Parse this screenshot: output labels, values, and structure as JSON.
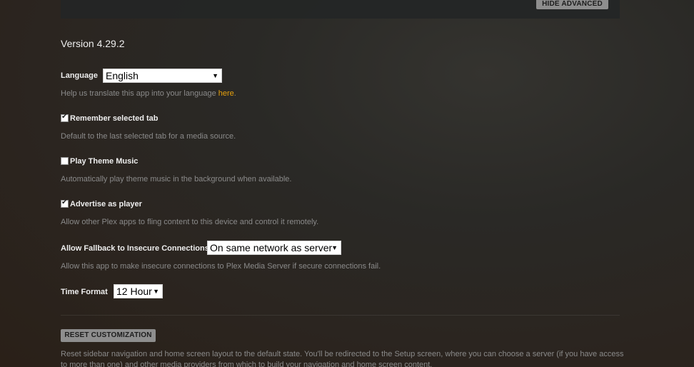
{
  "header": {
    "hide_advanced_label": "HIDE ADVANCED"
  },
  "version": "Version 4.29.2",
  "language": {
    "label": "Language",
    "value": "English",
    "help_prefix": "Help us translate this app into your language ",
    "help_link": "here",
    "help_suffix": "."
  },
  "remember_tab": {
    "checked": true,
    "label": "Remember selected tab",
    "help": "Default to the last selected tab for a media source."
  },
  "theme_music": {
    "checked": false,
    "label": "Play Theme Music",
    "help": "Automatically play theme music in the background when available."
  },
  "advertise": {
    "checked": true,
    "label": "Advertise as player",
    "help": "Allow other Plex apps to fling content to this device and control it remotely."
  },
  "fallback": {
    "label": "Allow Fallback to Insecure Connections",
    "value": "On same network as server",
    "help": "Allow this app to make insecure connections to Plex Media Server if secure connections fail."
  },
  "time_format": {
    "label": "Time Format",
    "value": "12 Hour"
  },
  "reset": {
    "button_label": "RESET CUSTOMIZATION",
    "help": "Reset sidebar navigation and home screen layout to the default state. You'll be redirected to the Setup screen, where you can choose a server (if you have access to more than one) and other media providers from which to build your navigation and home screen content."
  },
  "icons": {
    "check": "✔",
    "dropdown_arrow": "▼"
  },
  "colors": {
    "accent_link": "#e5a00d",
    "button_bg": "#8e8e8e",
    "help_text": "#8a8a8a"
  }
}
